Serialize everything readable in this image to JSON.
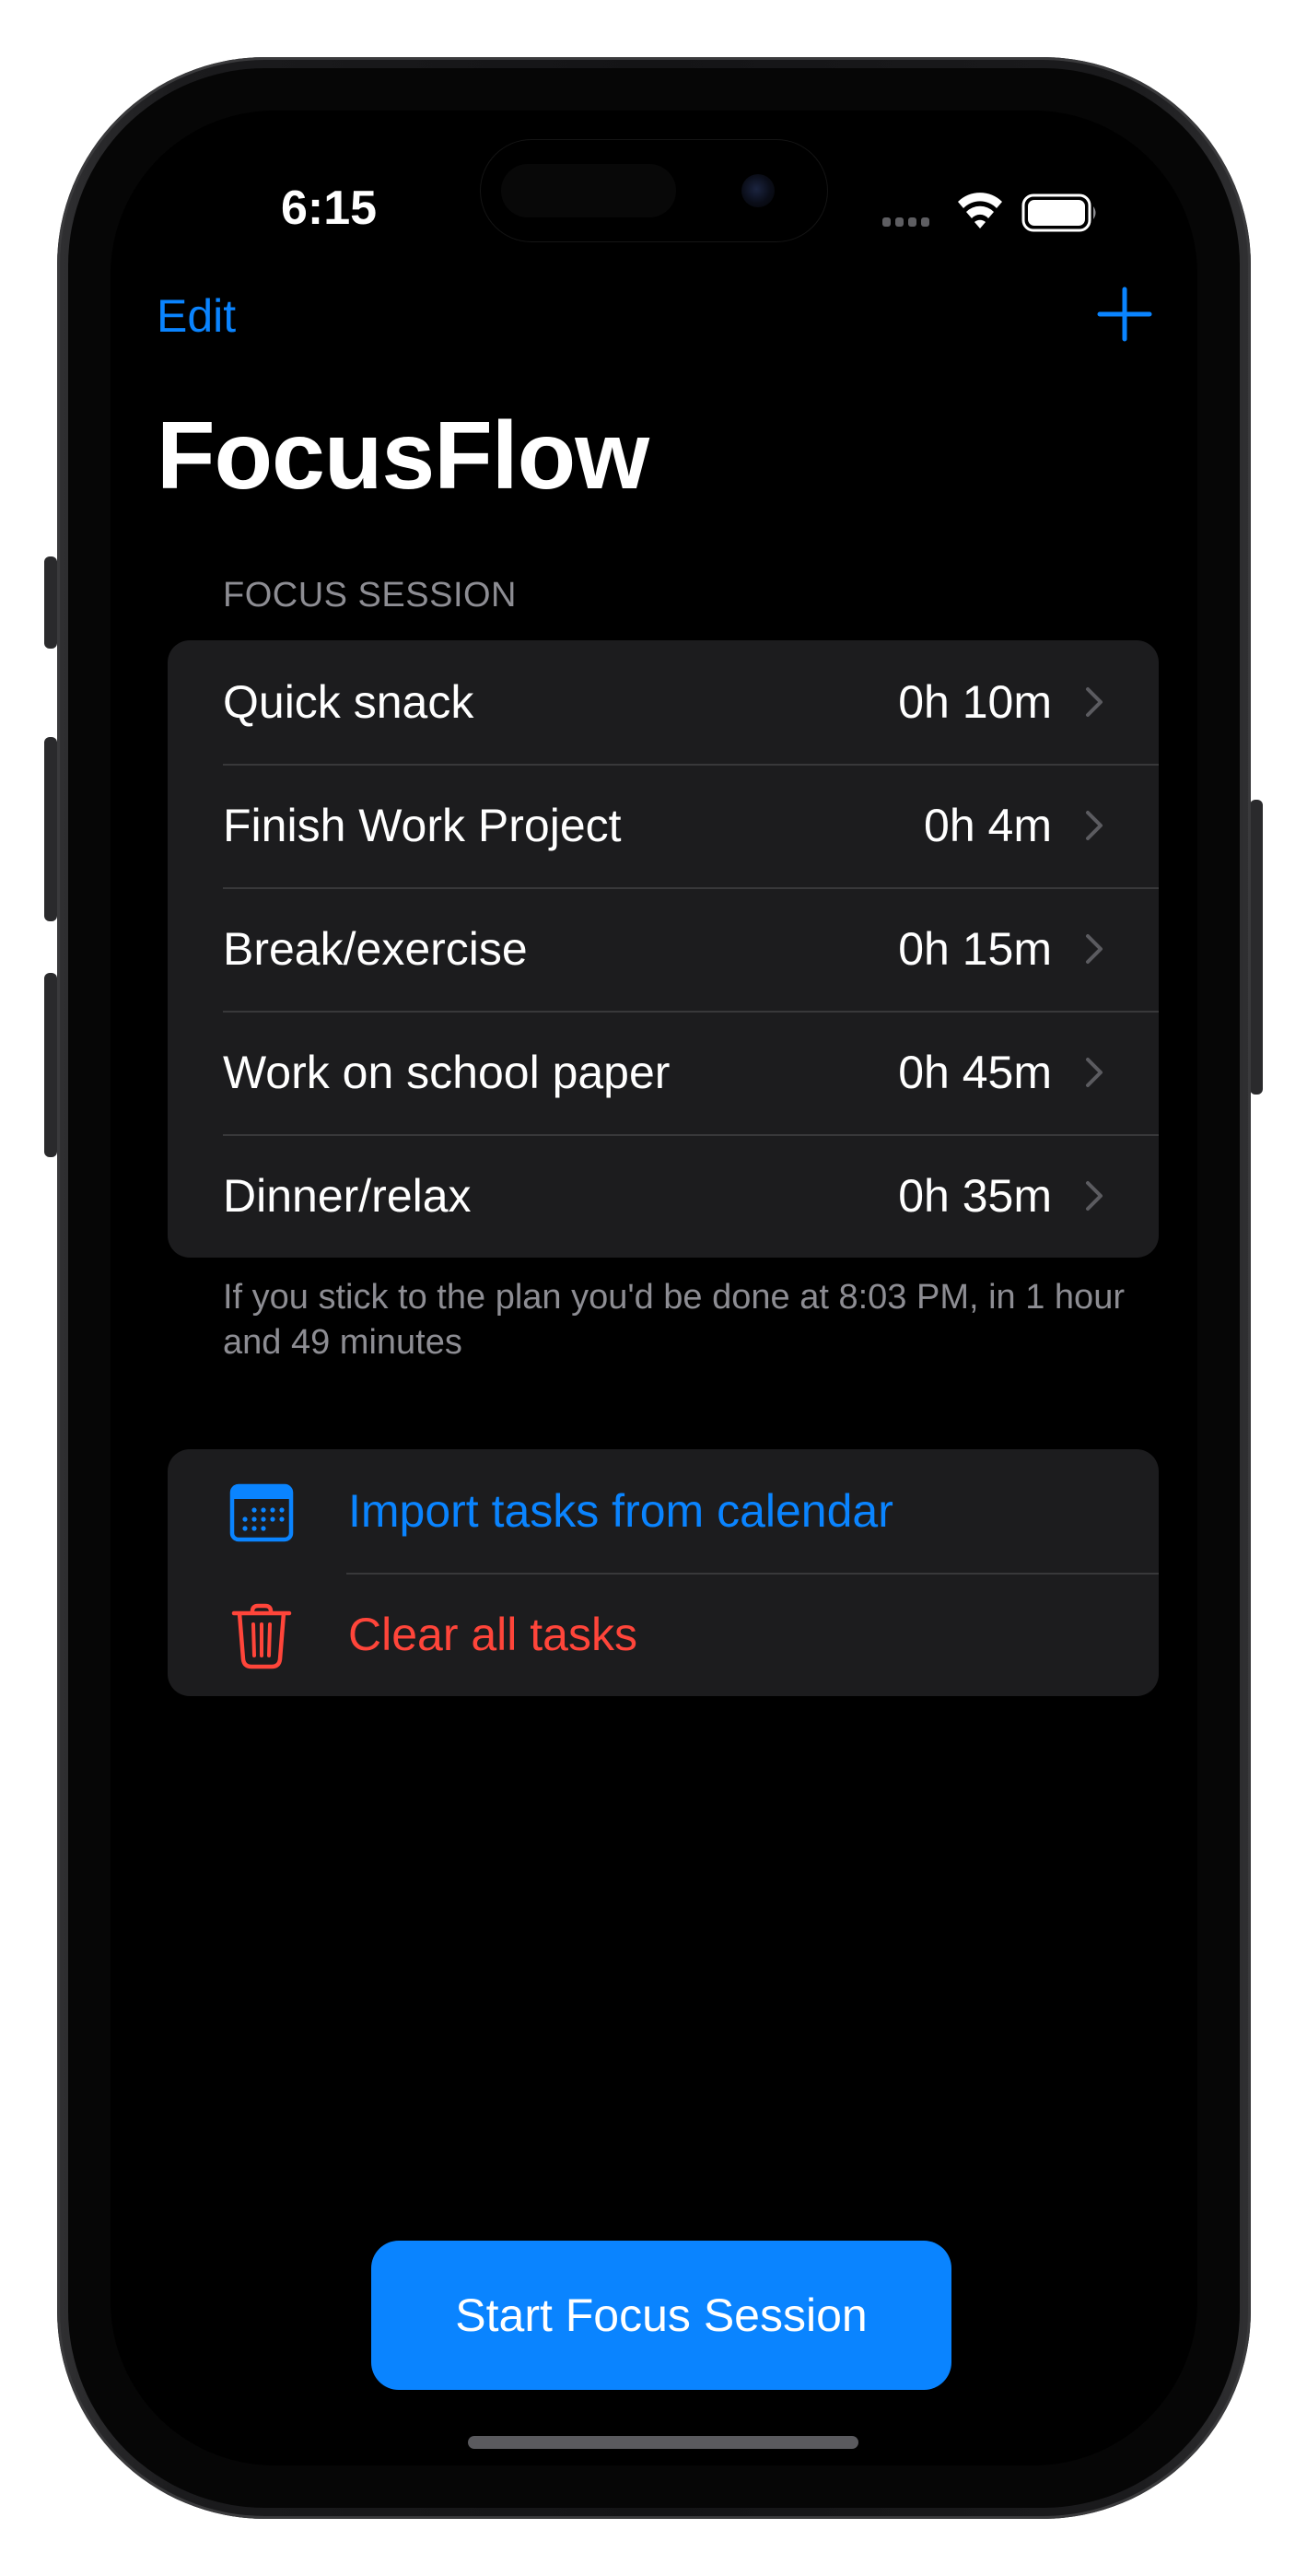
{
  "status_bar": {
    "time": "6:15"
  },
  "nav": {
    "edit_label": "Edit",
    "add_icon": "plus-icon",
    "title": "FocusFlow"
  },
  "focus_session": {
    "header": "FOCUS SESSION",
    "tasks": [
      {
        "title": "Quick snack",
        "duration": "0h 10m"
      },
      {
        "title": "Finish Work Project",
        "duration": "0h 4m"
      },
      {
        "title": "Break/exercise",
        "duration": "0h 15m"
      },
      {
        "title": "Work on school paper",
        "duration": "0h 45m"
      },
      {
        "title": "Dinner/relax",
        "duration": "0h 35m"
      }
    ],
    "footer": "If you stick to the plan you'd be done at 8:03 PM, in 1 hour and 49 minutes"
  },
  "actions": {
    "import_label": "Import tasks from calendar",
    "import_icon": "calendar-icon",
    "clear_label": "Clear all tasks",
    "clear_icon": "trash-icon"
  },
  "primary_button": {
    "label": "Start Focus Session"
  },
  "colors": {
    "accent": "#0a84ff",
    "destructive": "#ff453a",
    "background": "#000000",
    "group_background": "#1c1c1e",
    "secondary_text": "#8d8d93"
  }
}
